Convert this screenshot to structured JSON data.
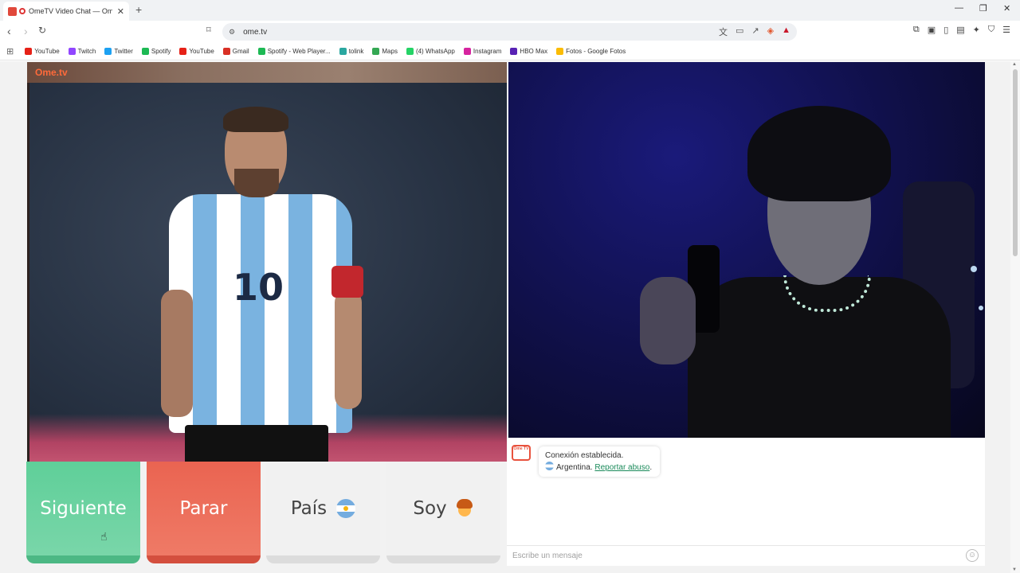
{
  "browser": {
    "tab_title": "OmeTV Video Chat — Omeg",
    "tab_close": "✕",
    "new_tab": "+",
    "window_controls": {
      "minimize": "—",
      "restore": "❐",
      "close": "✕"
    },
    "url": "ome.tv",
    "bookmarks": [
      {
        "label": "YouTube",
        "color": "#e62117"
      },
      {
        "label": "Twitch",
        "color": "#9146ff"
      },
      {
        "label": "Twitter",
        "color": "#1da1f2"
      },
      {
        "label": "Spotify",
        "color": "#1db954"
      },
      {
        "label": "YouTube",
        "color": "#e62117"
      },
      {
        "label": "Gmail",
        "color": "#d93025"
      },
      {
        "label": "Spotify - Web Player...",
        "color": "#1db954"
      },
      {
        "label": "tolink",
        "color": "#2aa7a0"
      },
      {
        "label": "Maps",
        "color": "#34a853"
      },
      {
        "label": "(4) WhatsApp",
        "color": "#25d366"
      },
      {
        "label": "Instagram",
        "color": "#d6249f"
      },
      {
        "label": "HBO Max",
        "color": "#5822b4"
      },
      {
        "label": "Fotos - Google Fotos",
        "color": "#fbbc04"
      }
    ]
  },
  "video": {
    "local_logo": "Ome.tv",
    "player_number": "10"
  },
  "controls": {
    "next_label": "Siguiente",
    "stop_label": "Parar",
    "country_label": "País",
    "gender_label": "Soy",
    "next_color": "#5fcf99",
    "stop_color": "#ea6451"
  },
  "chat": {
    "logo_text": "Ome TV",
    "connection_message": "Conexión establecida.",
    "country": "Argentina.",
    "report_link": "Reportar abuso",
    "report_suffix": ".",
    "input_placeholder": "Escribe un mensaje"
  }
}
